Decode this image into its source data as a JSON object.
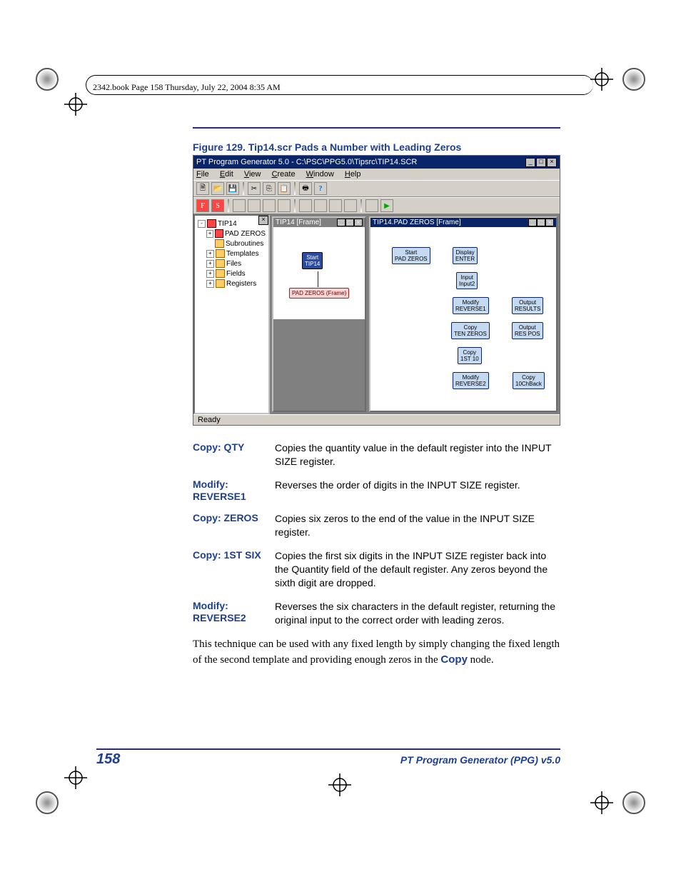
{
  "header_text": "2342.book  Page 158  Thursday, July 22, 2004  8:35 AM",
  "figure_caption": "Figure 129. Tip14.scr Pads a Number with Leading Zeros",
  "app": {
    "title": "PT Program Generator 5.0 - C:\\PSC\\PPG5.0\\Tipsrc\\TIP14.SCR",
    "menus": [
      "File",
      "Edit",
      "View",
      "Create",
      "Window",
      "Help"
    ],
    "tree": {
      "root": "TIP14",
      "items": [
        "PAD ZEROS",
        "Subroutines",
        "Templates",
        "Files",
        "Fields",
        "Registers"
      ]
    },
    "win1": {
      "title": "TIP14 [Frame]",
      "nodes": [
        "Start\nTIP14",
        "PAD ZEROS (Frame)"
      ]
    },
    "win2": {
      "title": "TIP14.PAD ZEROS [Frame]",
      "nodes": [
        "Start\nPAD ZEROS",
        "Display\nENTER",
        "Input\nInput2",
        "Modify\nREVERSE1",
        "Output\nRESULTS",
        "Copy\nTEN ZEROS",
        "Output\nRES POS",
        "Copy\n1ST 10",
        "Modify\nREVERSE2",
        "Copy\n10ChBack"
      ]
    },
    "status": "Ready"
  },
  "definitions": [
    {
      "term": "Copy: QTY",
      "def": "Copies the quantity value in the default register into the INPUT SIZE register."
    },
    {
      "term": "Modify: REVERSE1",
      "def": "Reverses the order of digits in the INPUT SIZE register."
    },
    {
      "term": "Copy: ZEROS",
      "def": "Copies six zeros to the end of the value in the INPUT SIZE register."
    },
    {
      "term": "Copy: 1ST SIX",
      "def": "Copies the first six digits in the INPUT SIZE register back into the Quantity field of the default register. Any zeros beyond the sixth digit are dropped."
    },
    {
      "term": "Modify: REVERSE2",
      "def": "Reverses the six characters in the default register, returning the original input to the correct order with leading zeros."
    }
  ],
  "body_paragraph_pre": "This technique can be used with any fixed length by simply changing the fixed length of the second template and providing enough zeros in the ",
  "body_paragraph_bold": "Copy",
  "body_paragraph_post": " node.",
  "page_number": "158",
  "footer_title": "PT Program Generator (PPG)  v5.0"
}
